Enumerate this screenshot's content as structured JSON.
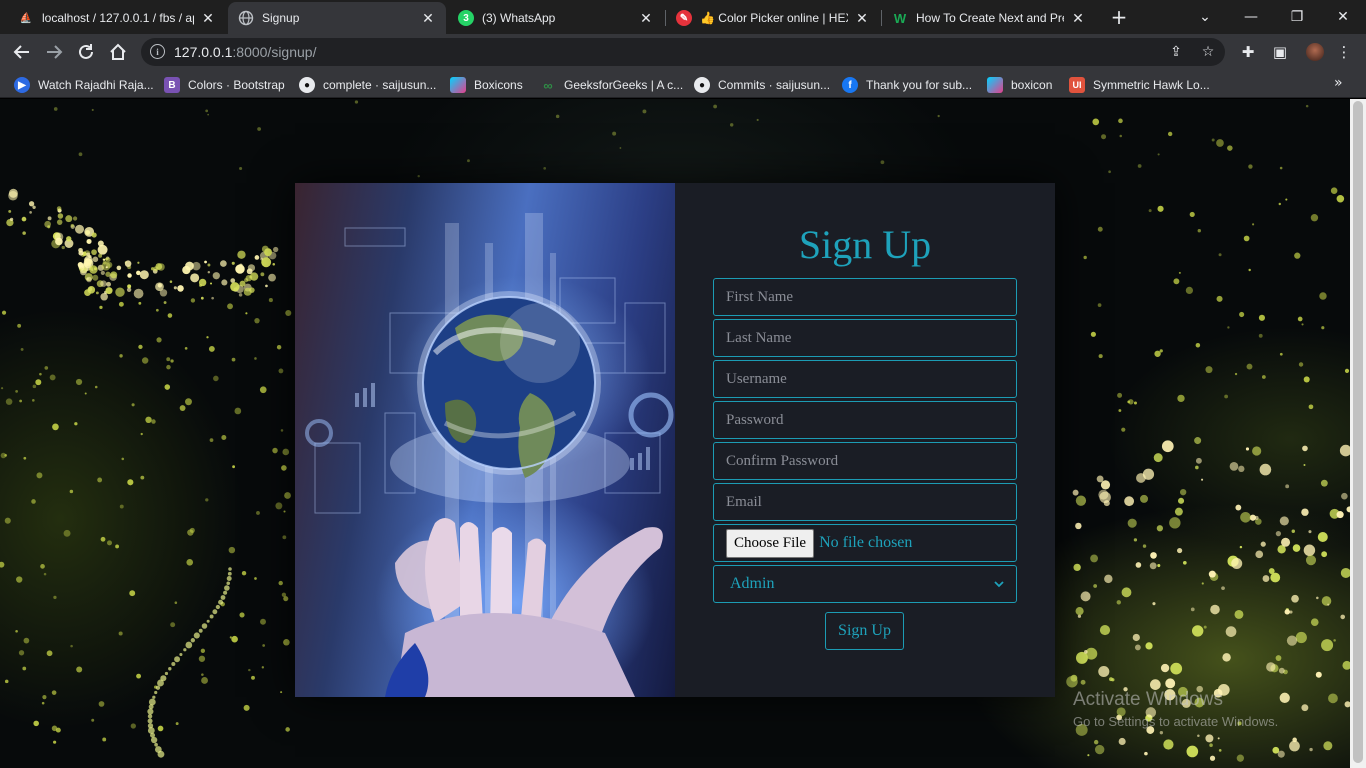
{
  "browser": {
    "tabs": [
      {
        "title": "localhost / 127.0.0.1 / fbs / ap",
        "icon": "phpmyadmin-icon",
        "active": false
      },
      {
        "title": "Signup",
        "icon": "globe-icon",
        "active": true
      },
      {
        "title": "(3) WhatsApp",
        "icon": "whatsapp-icon",
        "badge": "3",
        "active": false
      },
      {
        "title": "👍 Color Picker online | HEX",
        "icon": "color-picker-icon",
        "active": false
      },
      {
        "title": "How To Create Next and Prev",
        "icon": "w3docs-icon",
        "active": false
      }
    ],
    "url": {
      "host": "127.0.0.1",
      "rest": ":8000/signup/"
    },
    "bookmarks": [
      {
        "label": "Watch Rajadhi Raja...",
        "icon": "play-icon",
        "color": "#2d6ae3"
      },
      {
        "label": "Colors · Bootstrap",
        "icon": "bootstrap-icon",
        "color": "#7952b3",
        "glyph": "B"
      },
      {
        "label": "complete · saijusun...",
        "icon": "github-icon",
        "color": "#e8eaed"
      },
      {
        "label": "Boxicons",
        "icon": "boxicons-icon",
        "color": "#e83e8c"
      },
      {
        "label": "GeeksforGeeks | A c...",
        "icon": "gfg-icon",
        "color": "#2f8d46",
        "glyph": "∞"
      },
      {
        "label": "Commits · saijusun...",
        "icon": "github-icon",
        "color": "#e8eaed"
      },
      {
        "label": "Thank you for sub...",
        "icon": "facebook-icon",
        "color": "#1877f2",
        "glyph": "f"
      },
      {
        "label": "boxicon",
        "icon": "boxicons-icon",
        "color": "#e83e8c"
      },
      {
        "label": "Symmetric Hawk Lo...",
        "icon": "ui-icon",
        "color": "#e0533d",
        "glyph": "UI"
      }
    ]
  },
  "signup": {
    "title": "Sign Up",
    "first_name_placeholder": "First Name",
    "last_name_placeholder": "Last Name",
    "username_placeholder": "Username",
    "password_placeholder": "Password",
    "confirm_password_placeholder": "Confirm Password",
    "email_placeholder": "Email",
    "file_button_label": "Choose File",
    "file_status": "No file chosen",
    "role_selected": "Admin",
    "submit_label": "Sign Up"
  },
  "watermark": {
    "line1": "Activate Windows",
    "line2": "Go to Settings to activate Windows."
  },
  "colors": {
    "accent": "#1ea2bb",
    "panel": "#1a1d25",
    "chrome_dark": "#1f1f1f",
    "chrome": "#35363a"
  }
}
